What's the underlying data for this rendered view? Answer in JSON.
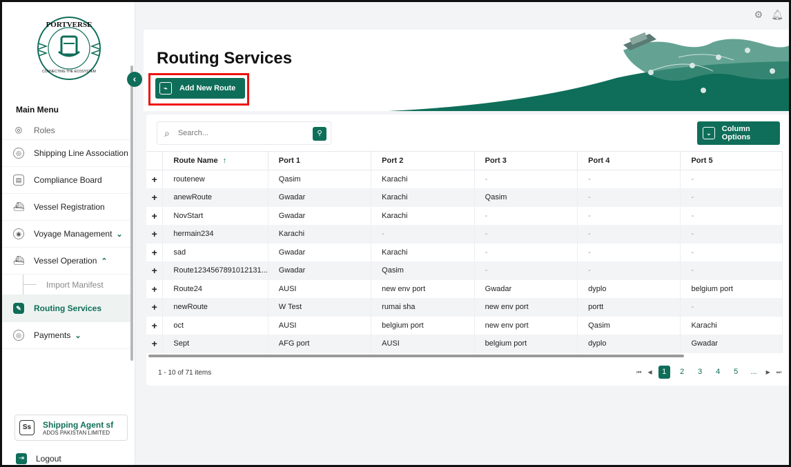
{
  "sidebar": {
    "menu_title": "Main Menu",
    "collapse_icon": "‹",
    "items": [
      {
        "label": "Roles",
        "icon": "roles-icon",
        "glyph": "◎"
      },
      {
        "label": "Shipping Line Association",
        "icon": "shipping-line-icon",
        "glyph": "◎"
      },
      {
        "label": "Compliance Board",
        "icon": "document-icon",
        "glyph": "▤"
      },
      {
        "label": "Vessel Registration",
        "icon": "ship-icon",
        "glyph": "⛴"
      },
      {
        "label": "Voyage Management",
        "icon": "voyage-icon",
        "glyph": "◉",
        "chevron": "⌄"
      },
      {
        "label": "Vessel Operation",
        "icon": "vessel-operation-icon",
        "glyph": "⛴",
        "chevron": "⌃"
      },
      {
        "label": "Import Manifest"
      },
      {
        "label": "Routing Services",
        "icon": "route-icon",
        "glyph": "✎"
      },
      {
        "label": "Payments",
        "icon": "payments-icon",
        "glyph": "◎",
        "chevron": "⌄"
      }
    ],
    "user": {
      "initials": "Ss",
      "name": "Shipping Agent sf",
      "org": "ADOS PAKISTAN LIMITED"
    },
    "logout_label": "Logout"
  },
  "logo": {
    "top_text": "PORTVERSE",
    "bottom_text": "CONNECTING THE ECOSYSTEM"
  },
  "header": {
    "title": "Routing Services",
    "add_route_label": "Add New Route"
  },
  "toolbar": {
    "search_placeholder": "Search...",
    "column_options_label": "Column Options"
  },
  "table": {
    "columns": [
      "Route Name",
      "Port 1",
      "Port 2",
      "Port 3",
      "Port 4",
      "Port 5"
    ],
    "sort_indicator": "↑",
    "rows": [
      [
        "routenew",
        "Qasim",
        "Karachi",
        "-",
        "-",
        "-"
      ],
      [
        "anewRoute",
        "Gwadar",
        "Karachi",
        "Qasim",
        "-",
        "-"
      ],
      [
        "NovStart",
        "Gwadar",
        "Karachi",
        "-",
        "-",
        "-"
      ],
      [
        "hermain234",
        "Karachi",
        "-",
        "-",
        "-",
        "-"
      ],
      [
        "sad",
        "Gwadar",
        "Karachi",
        "-",
        "-",
        "-"
      ],
      [
        "Route1234567891012131...",
        "Gwadar",
        "Qasim",
        "-",
        "-",
        "-"
      ],
      [
        "Route24",
        "AUSI",
        "new env port",
        "Gwadar",
        "dyplo",
        "belgium port"
      ],
      [
        "newRoute",
        "W Test",
        "rumai sha",
        "new env port",
        "portt",
        "-"
      ],
      [
        "oct",
        "AUSI",
        "belgium port",
        "new env port",
        "Qasim",
        "Karachi"
      ],
      [
        "Sept",
        "AFG port",
        "AUSI",
        "belgium port",
        "dyplo",
        "Gwadar"
      ]
    ]
  },
  "pagination": {
    "info": "1 - 10 of 71 items",
    "pages": [
      "1",
      "2",
      "3",
      "4",
      "5",
      "..."
    ],
    "current": "1"
  },
  "colors": {
    "brand": "#0f6e59",
    "highlight": "#e11111"
  }
}
